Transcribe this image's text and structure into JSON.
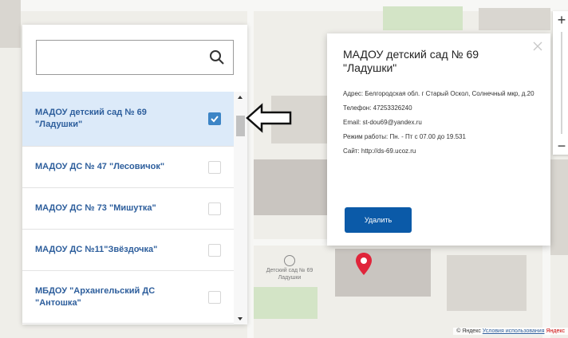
{
  "search": {
    "placeholder": "",
    "value": ""
  },
  "list": {
    "items": [
      {
        "label": "МАДОУ детский сад № 69 \"Ладушки\"",
        "checked": true
      },
      {
        "label": "МАДОУ ДС № 47 \"Лесовичок\"",
        "checked": false
      },
      {
        "label": "МАДОУ ДС № 73 \"Мишутка\"",
        "checked": false
      },
      {
        "label": "МАДОУ ДС №11\"Звёздочка\"",
        "checked": false
      },
      {
        "label": "МБДОУ \"Архангельский ДС \"Антошка\"",
        "checked": false
      }
    ]
  },
  "card": {
    "title": "МАДОУ детский сад № 69 \"Ладушки\"",
    "address": "Адрес: Белгородская обл. г Старый Оскол, Солнечный мкр, д.20",
    "phone": "Телефон: 47253326240",
    "email": "Email: st-dou69@yandex.ru",
    "hours": "Режим работы: Пн. - Пт с 07.00 до 19.531",
    "site": "Сайт: http://ds-69.ucoz.ru",
    "delete_label": "Удалить"
  },
  "map": {
    "label": "Детский сад № 69 Ладушки",
    "zoom_in": "+",
    "zoom_out": "−",
    "copyright_prefix": "© Яндекс",
    "copyright_link": "Условия использования",
    "copyright_brand": "Яндекс"
  },
  "colors": {
    "accent": "#3d85c6",
    "button": "#0b5aa8",
    "pin": "#e0253b",
    "link": "#2d5e9c"
  }
}
